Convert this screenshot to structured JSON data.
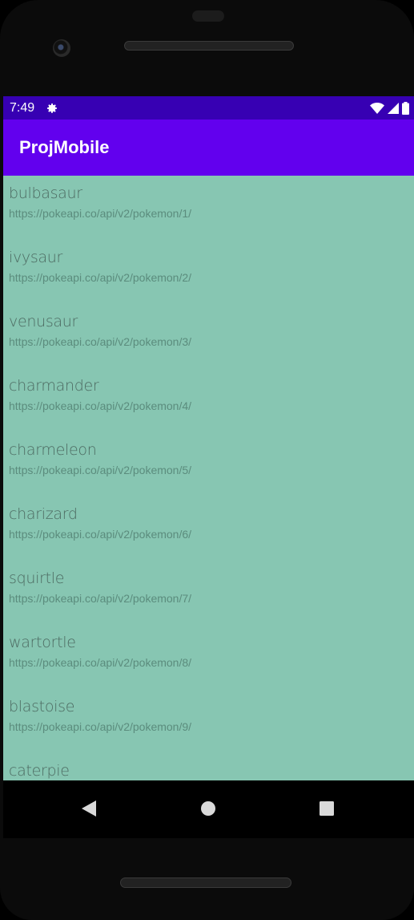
{
  "status_bar": {
    "time": "7:49",
    "icons": [
      "gear-icon",
      "wifi-icon",
      "signal-icon",
      "battery-icon"
    ]
  },
  "app_bar": {
    "title": "ProjMobile"
  },
  "list": {
    "items": [
      {
        "name": "bulbasaur",
        "url": "https://pokeapi.co/api/v2/pokemon/1/"
      },
      {
        "name": "ivysaur",
        "url": "https://pokeapi.co/api/v2/pokemon/2/"
      },
      {
        "name": "venusaur",
        "url": "https://pokeapi.co/api/v2/pokemon/3/"
      },
      {
        "name": "charmander",
        "url": "https://pokeapi.co/api/v2/pokemon/4/"
      },
      {
        "name": "charmeleon",
        "url": "https://pokeapi.co/api/v2/pokemon/5/"
      },
      {
        "name": "charizard",
        "url": "https://pokeapi.co/api/v2/pokemon/6/"
      },
      {
        "name": "squirtle",
        "url": "https://pokeapi.co/api/v2/pokemon/7/"
      },
      {
        "name": "wartortle",
        "url": "https://pokeapi.co/api/v2/pokemon/8/"
      },
      {
        "name": "blastoise",
        "url": "https://pokeapi.co/api/v2/pokemon/9/"
      },
      {
        "name": "caterpie",
        "url": ""
      }
    ]
  },
  "nav_bar": {
    "icons": [
      "back-icon",
      "home-icon",
      "recents-icon"
    ]
  },
  "colors": {
    "status_bar": "#3700b3",
    "app_bar": "#6200ee",
    "list_background": "#87c6b2"
  }
}
